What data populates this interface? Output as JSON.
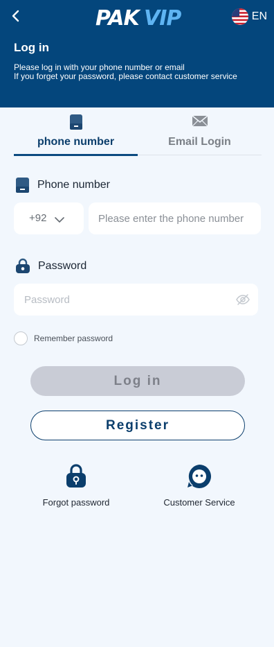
{
  "header": {
    "brand": "PAKVIP",
    "language": "EN",
    "title": "Log in",
    "line1": "Please log in with your phone number or email",
    "line2": "If you forget your password, please contact customer service"
  },
  "tabs": [
    {
      "label": "phone number",
      "icon": "phone-icon",
      "active": true
    },
    {
      "label": "Email Login",
      "icon": "mail-icon",
      "active": false
    }
  ],
  "phone_section": {
    "label": "Phone number",
    "country_code": "+92",
    "placeholder": "Please enter the phone number"
  },
  "password_section": {
    "label": "Password",
    "placeholder": "Password"
  },
  "remember_label": "Remember password",
  "buttons": {
    "login": "Log in",
    "register": "Register"
  },
  "bottom": {
    "forgot": "Forgot password",
    "service": "Customer Service"
  },
  "colors": {
    "header_bg": "#04467c",
    "primary": "#0b3e6c",
    "page_bg": "#f2f7fd",
    "login_disabled": "#c9ccd6"
  }
}
